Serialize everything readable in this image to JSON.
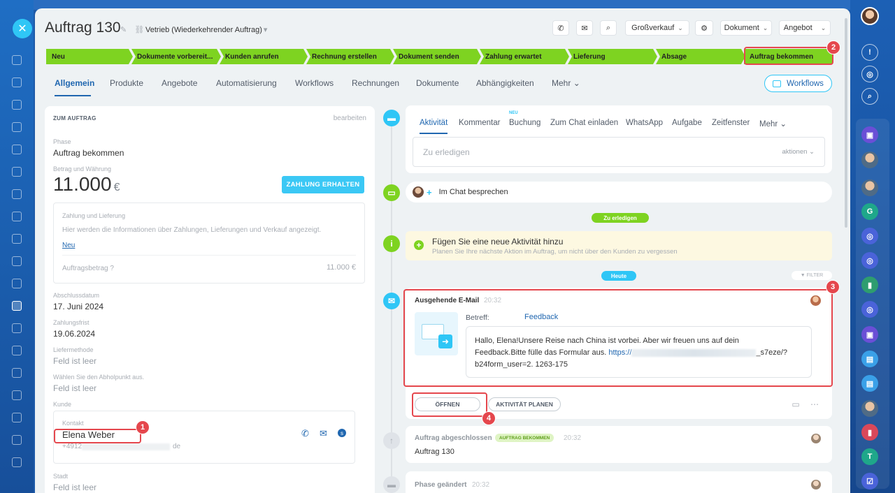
{
  "header": {
    "title": "Auftrag 130",
    "category": "Vetrieb (Wiederkehrender Auftrag)",
    "buttons": {
      "grossverkauf": "Großverkauf",
      "dokument": "Dokument",
      "angebot": "Angebot"
    }
  },
  "stages": [
    "Neu",
    "Dokumente vorbereit...",
    "Kunden anrufen",
    "Rechnung erstellen",
    "Dokument senden",
    "Zahlung erwartet",
    "Lieferung",
    "Absage",
    "Auftrag bekommen"
  ],
  "colors": {
    "stage": "#7ed321",
    "accent": "#2fc6f6",
    "link": "#2067b0",
    "highlight": "#e5474d"
  },
  "tabs": [
    "Allgemein",
    "Produkte",
    "Angebote",
    "Automatisierung",
    "Workflows",
    "Rechnungen",
    "Dokumente",
    "Abhängigkeiten",
    "Mehr"
  ],
  "workflows_button": "Workflows",
  "left": {
    "section": "ZUM AUFTRAG",
    "edit": "bearbeiten",
    "phase_label": "Phase",
    "phase_value": "Auftrag bekommen",
    "amount_label": "Betrag und Währung",
    "amount": "11.000",
    "currency": "€",
    "pay_button": "ZAHLUNG ERHALTEN",
    "payment_title": "Zahlung und Lieferung",
    "payment_desc": "Hier werden die Informationen über Zahlungen, Lieferungen und Verkauf angezeigt.",
    "payment_new": "Neu",
    "order_amount_label": "Auftragsbetrag",
    "order_amount_value": "11.000 €",
    "close_date_label": "Abschlussdatum",
    "close_date": "17. Juni 2024",
    "due_label": "Zahlungsfrist",
    "due": "19.06.2024",
    "delivery_label": "Liefermethode",
    "delivery": "Feld ist leer",
    "pickup_label": "Wählen Sie den Abholpunkt aus.",
    "pickup": "Feld ist leer",
    "customer_label": "Kunde",
    "contact_label": "Kontakt",
    "contact_name": "Elena Weber",
    "contact_phone": "+4912",
    "contact_mail_end": "de",
    "city_label": "Stadt",
    "city": "Feld ist leer"
  },
  "activity": {
    "tabs": [
      "Aktivität",
      "Kommentar",
      "Buchung",
      "Zum Chat einladen",
      "WhatsApp",
      "Aufgabe",
      "Zeitfenster",
      "Mehr"
    ],
    "new_tag": "NEU",
    "todo_placeholder": "Zu erledigen",
    "todo_action": "aktionen",
    "chat": "Im Chat besprechen",
    "pill_todo": "Zu erledigen",
    "add_title": "Fügen Sie eine neue Aktivität hinzu",
    "add_desc": "Planen Sie Ihre nächste Aktion im Auftrag, um nicht über den Kunden zu vergessen",
    "pill_today": "Heute",
    "filter": "FILTER"
  },
  "mail": {
    "title": "Ausgehende E-Mail",
    "time": "20:32",
    "subject_label": "Betreff:",
    "subject": "Feedback",
    "body_1": "Hallo, Elena!Unsere Reise nach China ist vorbei. Aber wir freuen uns auf dein",
    "body_2a": "Feedback.Bitte fülle das Formular aus. ",
    "body_link": "https://",
    "body_2b": "_s7eze/?",
    "body_3": "b24form_user=2. 1263-175",
    "open": "ÖFFNEN",
    "plan": "AKTIVITÄT PLANEN"
  },
  "done": {
    "title": "Auftrag abgeschlossen",
    "tag": "AUFTRAG BEKOMMEN",
    "time": "20:32",
    "text": "Auftrag 130"
  },
  "phase_changed": {
    "title": "Phase geändert",
    "time": "20:32"
  },
  "annotations": [
    "1",
    "2",
    "3",
    "4"
  ],
  "right_rail": {
    "letter_g": "G",
    "letter_t": "T"
  }
}
